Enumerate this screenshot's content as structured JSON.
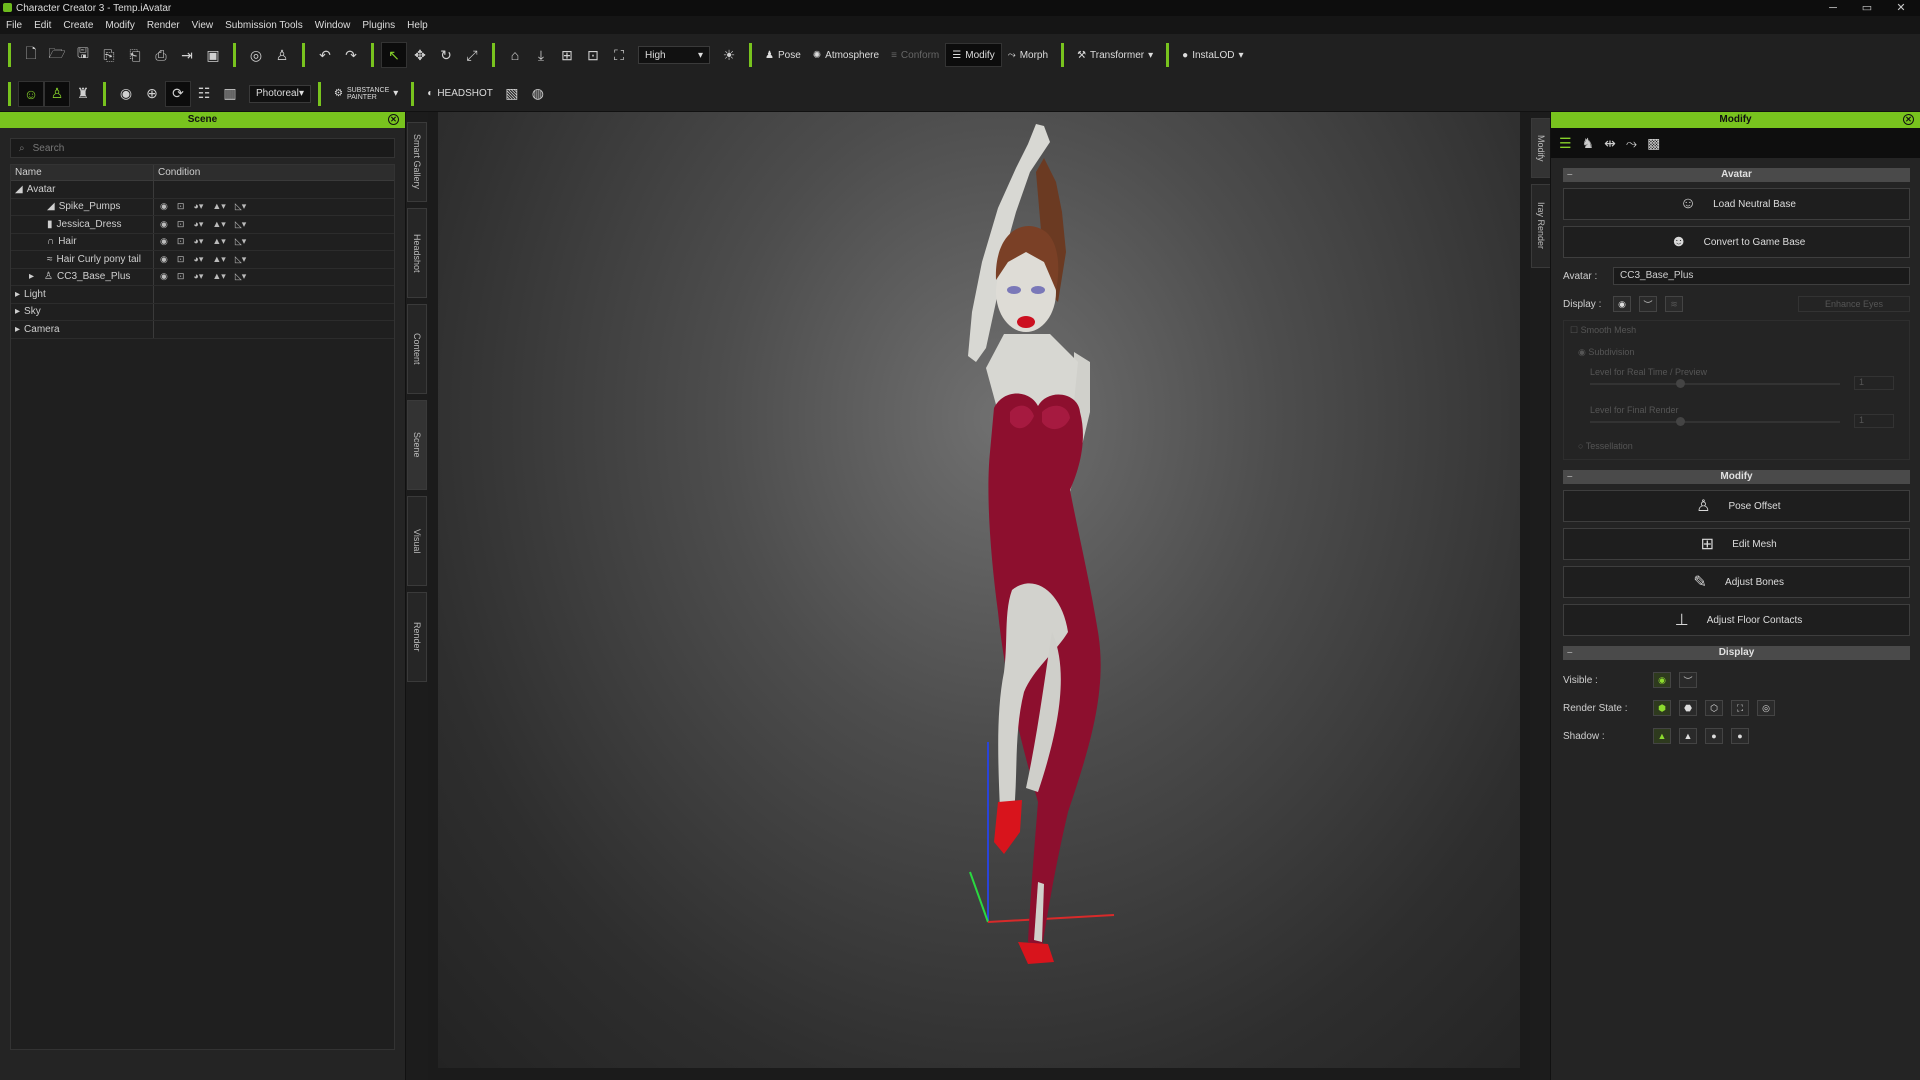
{
  "window": {
    "title": "Character Creator 3 - Temp.iAvatar",
    "min": "─",
    "max": "▭",
    "close": "✕"
  },
  "menu": [
    "File",
    "Edit",
    "Create",
    "Modify",
    "Render",
    "View",
    "Submission Tools",
    "Window",
    "Plugins",
    "Help"
  ],
  "toolbar": {
    "quality": "High",
    "pose": "Pose",
    "atmosphere": "Atmosphere",
    "conform": "Conform",
    "modify": "Modify",
    "morph": "Morph",
    "transformer": "Transformer",
    "instalod": "InstaLOD",
    "render_mode": "Photoreal",
    "substance_top": "SUBSTANCE",
    "substance_bottom": "PAINTER",
    "headshot": "HEADSHOT"
  },
  "scene": {
    "title": "Scene",
    "search_placeholder": "Search",
    "col_name": "Name",
    "col_condition": "Condition",
    "items": [
      {
        "label": "Avatar",
        "arrow": "◢",
        "icon": ""
      },
      {
        "label": "Spike_Pumps",
        "arrow": "",
        "icon": "◢"
      },
      {
        "label": "Jessica_Dress",
        "arrow": "",
        "icon": "▮"
      },
      {
        "label": "Hair",
        "arrow": "",
        "icon": "∩"
      },
      {
        "label": "Hair Curly pony tail",
        "arrow": "",
        "icon": "≈"
      },
      {
        "label": "CC3_Base_Plus",
        "arrow": "▸",
        "icon": "♙"
      },
      {
        "label": "Light",
        "arrow": "▸",
        "icon": ""
      },
      {
        "label": "Sky",
        "arrow": "▸",
        "icon": ""
      },
      {
        "label": "Camera",
        "arrow": "▸",
        "icon": ""
      }
    ]
  },
  "side_tabs": [
    "Smart Gallery",
    "Headshot",
    "Content",
    "Scene",
    "Visual",
    "Render"
  ],
  "right_tabs": [
    "Modify",
    "Iray Render"
  ],
  "modify_panel": {
    "title": "Modify",
    "avatar_section": "Avatar",
    "load_neutral": "Load Neutral Base",
    "convert_game": "Convert to Game Base",
    "avatar_label": "Avatar :",
    "avatar_value": "CC3_Base_Plus",
    "display_label": "Display :",
    "enhance_eyes": "Enhance Eyes",
    "smooth_mesh": "Smooth Mesh",
    "subdivision": "Subdivision",
    "level_realtime": "Level for Real Time / Preview",
    "level_final": "Level for Final Render",
    "level_value": "1",
    "tessellation": "Tessellation",
    "modify_section": "Modify",
    "pose_offset": "Pose Offset",
    "edit_mesh": "Edit Mesh",
    "adjust_bones": "Adjust Bones",
    "adjust_floor": "Adjust Floor Contacts",
    "display_section": "Display",
    "visible_label": "Visible :",
    "render_state_label": "Render State :",
    "shadow_label": "Shadow :"
  },
  "colors": {
    "accent": "#78c31e",
    "dress": "#8f1030",
    "skin": "#d7d7d2",
    "shoe": "#d8141c"
  }
}
